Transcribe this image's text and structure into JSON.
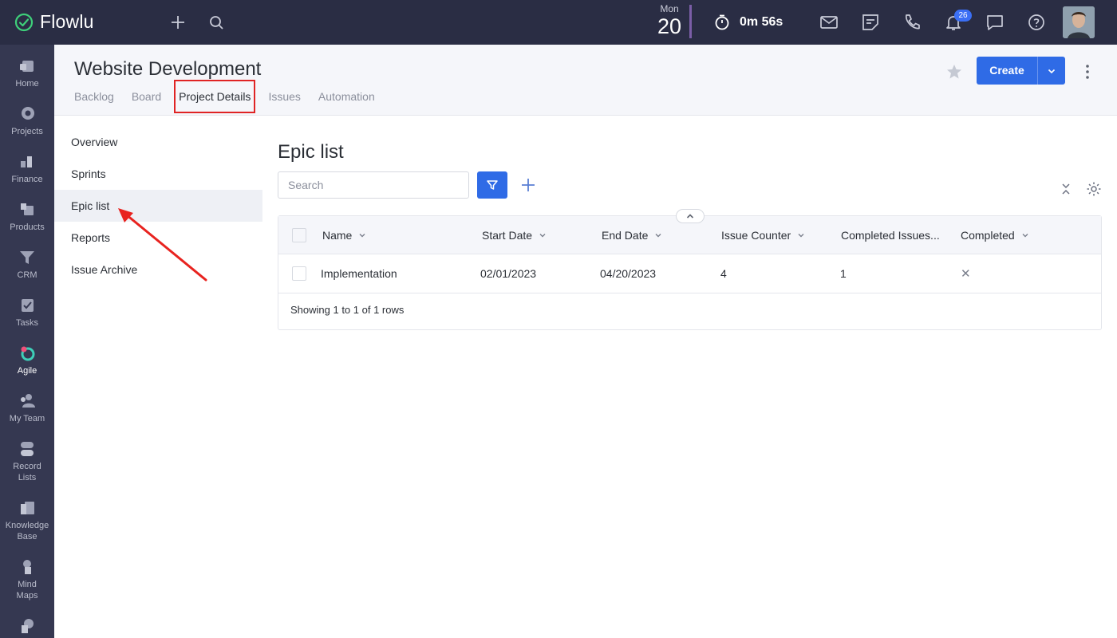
{
  "app": {
    "name": "Flowlu",
    "date_day": "Mon",
    "date_num": "20",
    "timer": "0m 56s",
    "notifications_count": "26",
    "accent": "#2f6be6"
  },
  "sidebar": {
    "items": [
      {
        "label": "Home",
        "icon": "home-icon"
      },
      {
        "label": "Projects",
        "icon": "projects-icon"
      },
      {
        "label": "Finance",
        "icon": "finance-icon"
      },
      {
        "label": "Products",
        "icon": "products-icon"
      },
      {
        "label": "CRM",
        "icon": "crm-icon"
      },
      {
        "label": "Tasks",
        "icon": "tasks-icon"
      },
      {
        "label": "Agile",
        "icon": "agile-icon",
        "active": true
      },
      {
        "label": "My Team",
        "icon": "team-icon"
      },
      {
        "label": "Record Lists",
        "icon": "record-lists-icon"
      },
      {
        "label": "Knowledge Base",
        "icon": "knowledge-base-icon"
      },
      {
        "label": "Mind Maps",
        "icon": "mind-maps-icon"
      }
    ]
  },
  "header": {
    "title": "Website Development",
    "tabs": [
      "Backlog",
      "Board",
      "Project Details",
      "Issues",
      "Automation"
    ],
    "active_tab": "Project Details",
    "create_label": "Create"
  },
  "subnav": {
    "items": [
      "Overview",
      "Sprints",
      "Epic list",
      "Reports",
      "Issue Archive"
    ],
    "active": "Epic list"
  },
  "content": {
    "title": "Epic list",
    "search_placeholder": "Search",
    "columns": [
      "Name",
      "Start Date",
      "End Date",
      "Issue Counter",
      "Completed Issues...",
      "Completed"
    ],
    "rows": [
      {
        "name": "Implementation",
        "start": "02/01/2023",
        "end": "04/20/2023",
        "issue_counter": "4",
        "completed_issues": "1",
        "completed": "✕"
      }
    ],
    "footer": "Showing 1 to 1 of 1 rows"
  }
}
